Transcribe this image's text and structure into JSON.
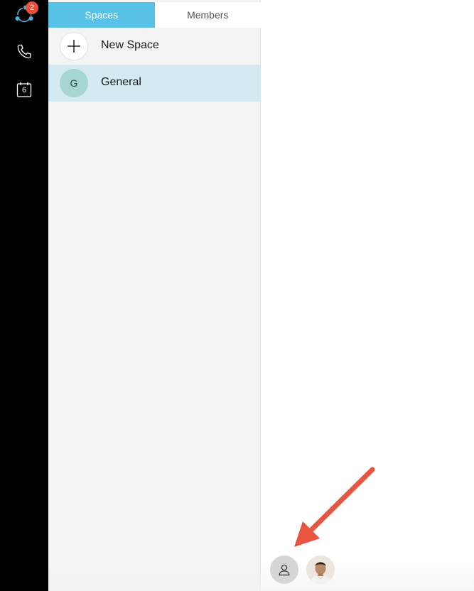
{
  "rail": {
    "items": [
      {
        "name": "teams",
        "icon": "teams-icon",
        "badge": "2"
      },
      {
        "name": "calls",
        "icon": "phone-icon"
      },
      {
        "name": "meetings",
        "icon": "calendar-icon",
        "calendar_day": "6"
      }
    ]
  },
  "tabs": [
    {
      "label": "Spaces",
      "active": true
    },
    {
      "label": "Members",
      "active": false
    }
  ],
  "spaces": {
    "new_space": {
      "label": "New Space",
      "icon": "plus-icon"
    },
    "items": [
      {
        "label": "General",
        "initial": "G",
        "selected": true
      }
    ]
  },
  "bottom": {
    "profile_icon": "person-icon",
    "user_avatar": "user-photo"
  },
  "colors": {
    "rail_bg": "#000000",
    "accent": "#58c2e6",
    "badge": "#e8503a",
    "selected_row": "#d3eaf1",
    "annotation_arrow": "#e8553e"
  }
}
